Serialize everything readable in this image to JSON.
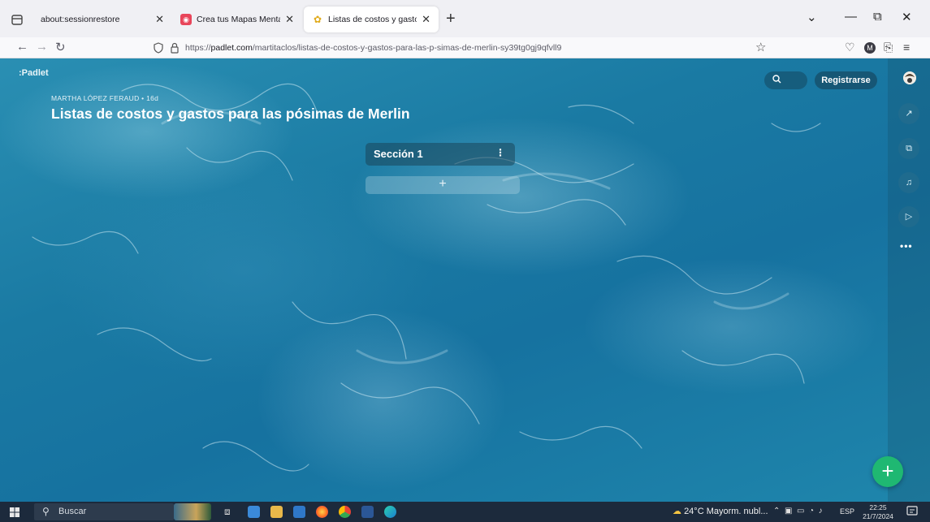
{
  "browser": {
    "tabs": [
      {
        "title": "about:sessionrestore",
        "active": false
      },
      {
        "title": "Crea tus Mapas Mentales en Lín",
        "active": false
      },
      {
        "title": "Listas de costos y gastos para l",
        "active": true
      }
    ],
    "new_tab_symbol": "+",
    "window_controls": {
      "list": "⌄",
      "minimize": "—",
      "maximize": "⧉",
      "close": "✕"
    },
    "url_prefix": "https://",
    "url_domain": "padlet.com",
    "url_path": "/martitaclos/listas-de-costos-y-gastos-para-las-p-simas-de-merlin-sy39tg0gj9qfvll9"
  },
  "padlet": {
    "logo": ":Padlet",
    "author": "MARTHA LÓPEZ FERAUD",
    "age": "16d",
    "title": "Listas de costos y gastos para las pósimas de Merlin",
    "register_label": "Registrarse",
    "section": {
      "name": "Sección 1",
      "menu": "⋮"
    },
    "add_symbol": "+",
    "more_symbol": "•••",
    "fab_symbol": "+"
  },
  "taskbar": {
    "search_placeholder": "Buscar",
    "weather": "24°C  Mayorm. nubl...",
    "language": "ESP",
    "time": "22:25",
    "date": "21/7/2024"
  },
  "colors": {
    "ocean": "#1c6f93",
    "fab": "#1fb872",
    "taskbar": "#1c2a3c",
    "tab_bar": "#f0f0f4"
  }
}
